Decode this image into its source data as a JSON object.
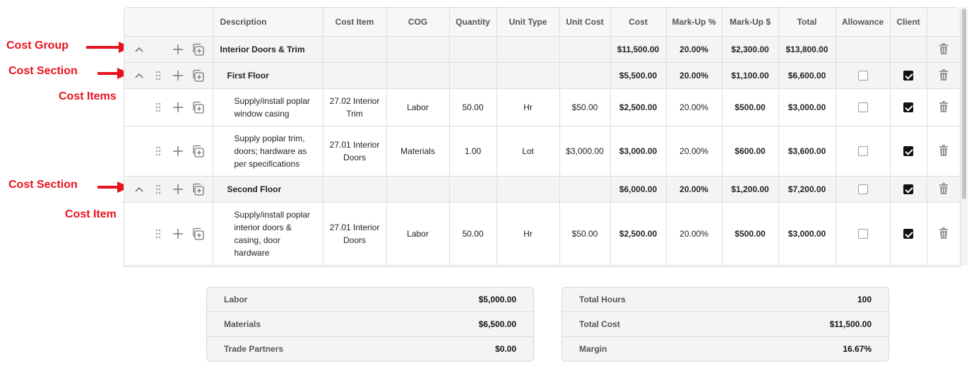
{
  "annotations": {
    "cost_group": "Cost Group",
    "cost_section_1": "Cost Section",
    "cost_items": "Cost Items",
    "cost_section_2": "Cost Section",
    "cost_item": "Cost Item",
    "arrow_color": "#e8121d"
  },
  "table": {
    "headers": {
      "description": "Description",
      "cost_item": "Cost Item",
      "cog": "COG",
      "quantity": "Quantity",
      "unit_type": "Unit Type",
      "unit_cost": "Unit Cost",
      "cost": "Cost",
      "markup_pct": "Mark-Up %",
      "markup_amt": "Mark-Up $",
      "total": "Total",
      "allowance": "Allowance",
      "client": "Client"
    },
    "group": {
      "description": "Interior Doors & Trim",
      "cost": "$11,500.00",
      "markup_pct": "20.00%",
      "markup_amt": "$2,300.00",
      "total": "$13,800.00"
    },
    "section1": {
      "description": "First Floor",
      "cost": "$5,500.00",
      "markup_pct": "20.00%",
      "markup_amt": "$1,100.00",
      "total": "$6,600.00",
      "allowance": false,
      "client": true
    },
    "item1": {
      "description": "Supply/install poplar window casing",
      "cost_item": "27.02 Interior Trim",
      "cog": "Labor",
      "quantity": "50.00",
      "unit_type": "Hr",
      "unit_cost": "$50.00",
      "cost": "$2,500.00",
      "markup_pct": "20.00%",
      "markup_amt": "$500.00",
      "total": "$3,000.00",
      "allowance": false,
      "client": true
    },
    "item2": {
      "description": "Supply poplar trim, doors; hardware as per specifications",
      "cost_item": "27.01 Interior Doors",
      "cog": "Materials",
      "quantity": "1.00",
      "unit_type": "Lot",
      "unit_cost": "$3,000.00",
      "cost": "$3,000.00",
      "markup_pct": "20.00%",
      "markup_amt": "$600.00",
      "total": "$3,600.00",
      "allowance": false,
      "client": true
    },
    "section2": {
      "description": "Second Floor",
      "cost": "$6,000.00",
      "markup_pct": "20.00%",
      "markup_amt": "$1,200.00",
      "total": "$7,200.00",
      "allowance": false,
      "client": true
    },
    "item3": {
      "description": "Supply/install poplar interior doors & casing, door hardware",
      "cost_item": "27.01 Interior Doors",
      "cog": "Labor",
      "quantity": "50.00",
      "unit_type": "Hr",
      "unit_cost": "$50.00",
      "cost": "$2,500.00",
      "markup_pct": "20.00%",
      "markup_amt": "$500.00",
      "total": "$3,000.00",
      "allowance": false,
      "client": true
    }
  },
  "summary_left": {
    "labor_label": "Labor",
    "labor_value": "$5,000.00",
    "materials_label": "Materials",
    "materials_value": "$6,500.00",
    "trade_label": "Trade Partners",
    "trade_value": "$0.00"
  },
  "summary_right": {
    "hours_label": "Total Hours",
    "hours_value": "100",
    "cost_label": "Total Cost",
    "cost_value": "$11,500.00",
    "margin_label": "Margin",
    "margin_value": "16.67%"
  }
}
